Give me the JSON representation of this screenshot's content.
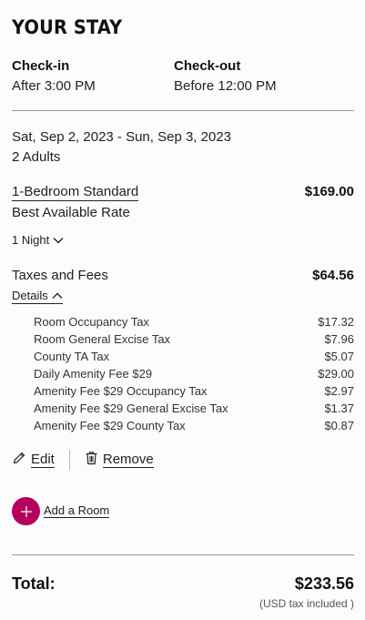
{
  "header": {
    "title": "YOUR STAY"
  },
  "check_in": {
    "label": "Check-in",
    "value": "After 3:00 PM"
  },
  "check_out": {
    "label": "Check-out",
    "value": "Before 12:00 PM"
  },
  "stay": {
    "dates": "Sat, Sep 2, 2023 - Sun, Sep 3, 2023",
    "guests": "2 Adults"
  },
  "room": {
    "name": "1-Bedroom Standard",
    "price": "$169.00",
    "rate": "Best Available Rate",
    "nights": "1 Night"
  },
  "taxes": {
    "label": "Taxes and Fees",
    "total": "$64.56",
    "details_label": "Details",
    "items": [
      {
        "name": "Room Occupancy Tax",
        "amount": "$17.32"
      },
      {
        "name": "Room General Excise Tax",
        "amount": "$7.96"
      },
      {
        "name": "County TA Tax",
        "amount": "$5.07"
      },
      {
        "name": "Daily Amenity Fee $29",
        "amount": "$29.00"
      },
      {
        "name": "Amenity Fee $29 Occupancy Tax",
        "amount": "$2.97"
      },
      {
        "name": "Amenity Fee $29 General Excise Tax",
        "amount": "$1.37"
      },
      {
        "name": "Amenity Fee $29 County Tax",
        "amount": "$0.87"
      }
    ]
  },
  "actions": {
    "edit_label": "Edit",
    "remove_label": "Remove",
    "add_room_label": "Add a Room"
  },
  "total": {
    "label": "Total:",
    "value": "$233.56",
    "note": "(USD tax included )"
  },
  "colors": {
    "accent": "#b5005e",
    "divider": "#9a9a9a"
  },
  "icons": {
    "nights": "chevron-down-icon",
    "details": "chevron-up-icon",
    "edit": "pencil-icon",
    "remove": "trash-icon",
    "add_room": "plus-circle-icon"
  }
}
